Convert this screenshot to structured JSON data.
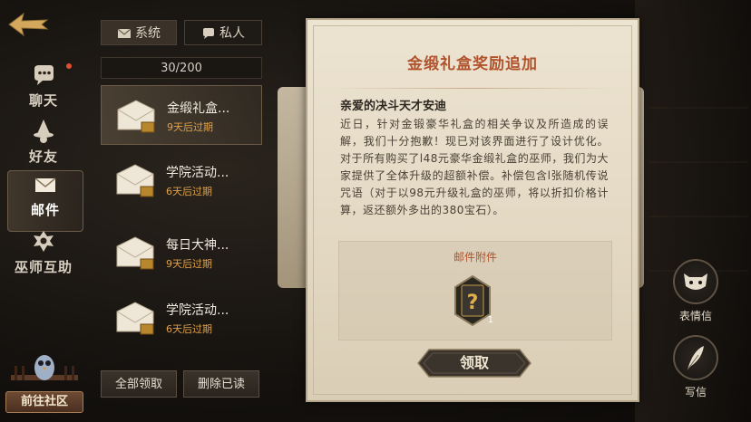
{
  "nav": {
    "items": [
      {
        "label": "聊天"
      },
      {
        "label": "好友"
      },
      {
        "label": "邮件"
      },
      {
        "label": "巫师互助"
      }
    ],
    "community_label": "前往社区"
  },
  "tabs": {
    "system": "系统",
    "private": "私人"
  },
  "mail_count": "30/200",
  "mails": [
    {
      "title": "金缎礼盒...",
      "expiry": "9天后过期"
    },
    {
      "title": "学院活动...",
      "expiry": "6天后过期"
    },
    {
      "title": "每日大神...",
      "expiry": "9天后过期"
    },
    {
      "title": "学院活动...",
      "expiry": "6天后过期"
    }
  ],
  "buttons": {
    "claim_all": "全部领取",
    "delete_read": "删除已读",
    "claim": "领取"
  },
  "letter": {
    "title": "金缎礼盒奖励追加",
    "greeting": "亲爱的决斗天才安迪",
    "body": "近日，针对金锻豪华礼盒的相关争议及所造成的误解，我们十分抱歉！现已对该界面进行了设计优化。对于所有购买了l48元豪华金缎礼盒的巫师，我们为大家提供了全体升级的超额补偿。补偿包含l张随机传说咒语（对于以98元升级礼盒的巫师，将以折扣价格计算，返还额外多出的380宝石）。",
    "attachment_label": "邮件附件",
    "attachment_count": "1"
  },
  "side": {
    "emoji_letter": "表情信",
    "write_letter": "写信"
  },
  "colors": {
    "accent": "#b0532d",
    "expiry": "#e0a24a",
    "alert_dot": "#e0502e"
  }
}
